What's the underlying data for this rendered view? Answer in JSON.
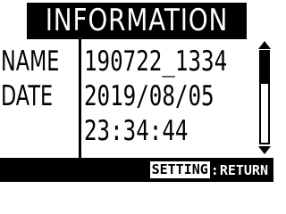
{
  "screen": {
    "title": "INFORMATION"
  },
  "info": {
    "rows": [
      {
        "label": "NAME",
        "value": "190722_1334"
      },
      {
        "label": "DATE",
        "value": "2019/08/05"
      },
      {
        "label": "",
        "value": "23:34:44"
      }
    ]
  },
  "footer": {
    "key": "SETTING",
    "separator": ":",
    "action": "RETURN"
  },
  "icons": {
    "scroll_up": "triangle-up-icon",
    "scroll_down": "triangle-down-icon"
  },
  "colors": {
    "background": "#ffffff",
    "foreground": "#000000"
  }
}
